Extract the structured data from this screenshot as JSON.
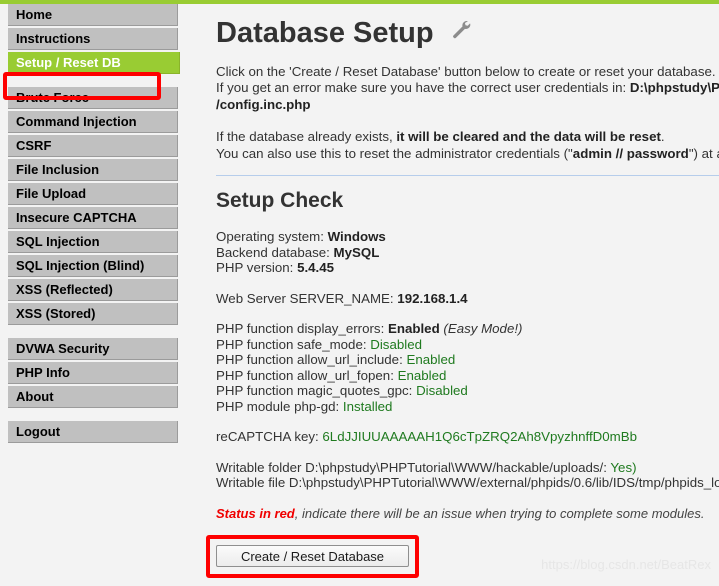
{
  "top_bar": {
    "color": "#99cc33"
  },
  "sidebar": {
    "groups": [
      {
        "items": [
          {
            "label": "Home",
            "active": false
          },
          {
            "label": "Instructions",
            "active": false
          },
          {
            "label": "Setup / Reset DB",
            "active": true
          }
        ]
      },
      {
        "items": [
          {
            "label": "Brute Force",
            "active": false
          },
          {
            "label": "Command Injection",
            "active": false
          },
          {
            "label": "CSRF",
            "active": false
          },
          {
            "label": "File Inclusion",
            "active": false
          },
          {
            "label": "File Upload",
            "active": false
          },
          {
            "label": "Insecure CAPTCHA",
            "active": false
          },
          {
            "label": "SQL Injection",
            "active": false
          },
          {
            "label": "SQL Injection (Blind)",
            "active": false
          },
          {
            "label": "XSS (Reflected)",
            "active": false
          },
          {
            "label": "XSS (Stored)",
            "active": false
          }
        ]
      },
      {
        "items": [
          {
            "label": "DVWA Security",
            "active": false
          },
          {
            "label": "PHP Info",
            "active": false
          },
          {
            "label": "About",
            "active": false
          }
        ]
      },
      {
        "items": [
          {
            "label": "Logout",
            "active": false
          }
        ]
      }
    ],
    "active_color": "#99cc33",
    "item_color": "#c0c0c0"
  },
  "main": {
    "title": "Database Setup",
    "title_icon": "wrench-icon",
    "intro": {
      "line1": "Click on the 'Create / Reset Database' button below to create or reset your database.",
      "line2_prefix": "If you get an error make sure you have the correct user credentials in: ",
      "line2_path": "D:\\phpstudy\\PHPTutorial\\WWW",
      "line3_path": "/config.inc.php",
      "line4_prefix": "If the database already exists, ",
      "line4_bold": "it will be cleared and the data will be reset",
      "line4_suffix": ".",
      "line5_prefix": "You can also use this to reset the administrator credentials (\"",
      "line5_bold": "admin // password",
      "line5_suffix": "\") at any stage."
    },
    "setup_check": {
      "heading": "Setup Check",
      "rows": [
        {
          "label": "Operating system: ",
          "value": "Windows",
          "style": "bold"
        },
        {
          "label": "Backend database: ",
          "value": "MySQL",
          "style": "bold"
        },
        {
          "label": "PHP version: ",
          "value": "5.4.45",
          "style": "bold"
        },
        {
          "gap": true
        },
        {
          "label": "Web Server SERVER_NAME: ",
          "value": "192.168.1.4",
          "style": "bold"
        },
        {
          "gap": true
        },
        {
          "label": "PHP function display_errors: ",
          "value": "Enabled",
          "style": "bold",
          "note": " (Easy Mode!)"
        },
        {
          "label": "PHP function safe_mode: ",
          "value": "Disabled",
          "style": "ok"
        },
        {
          "label": "PHP function allow_url_include: ",
          "value": "Enabled",
          "style": "ok"
        },
        {
          "label": "PHP function allow_url_fopen: ",
          "value": "Enabled",
          "style": "ok"
        },
        {
          "label": "PHP function magic_quotes_gpc: ",
          "value": "Disabled",
          "style": "ok"
        },
        {
          "label": "PHP module php-gd: ",
          "value": "Installed",
          "style": "ok"
        },
        {
          "gap": true
        },
        {
          "label": "reCAPTCHA key: ",
          "value": "6LdJJIUUAAAAAH1Q6cTpZRQ2Ah8VpyzhnffD0mBb",
          "style": "ok"
        },
        {
          "gap": true
        },
        {
          "label": "Writable folder D:\\phpstudy\\PHPTutorial\\WWW/hackable/uploads/: ",
          "value": "Yes)",
          "style": "ok"
        },
        {
          "label": "Writable file D:\\phpstudy\\PHPTutorial\\WWW/external/phpids/0.6/lib/IDS/tmp/phpids_log.txt: ",
          "value": "",
          "style": "plain"
        }
      ]
    },
    "status_note": {
      "red_text": "Status in red",
      "rest": ", indicate there will be an issue when trying to complete some modules."
    },
    "submit_button": "Create / Reset Database"
  },
  "annotations": {
    "nav_highlight_color": "#fe0000",
    "button_highlight_color": "#fe0000"
  },
  "watermark": "https://blog.csdn.net/BeatRex"
}
